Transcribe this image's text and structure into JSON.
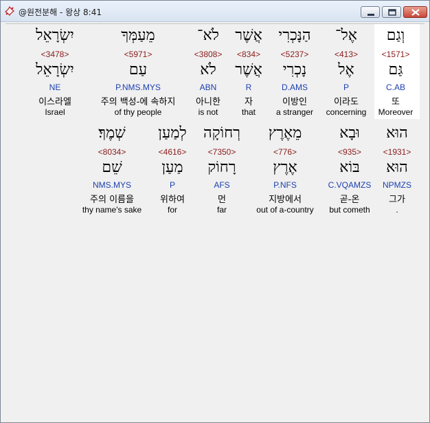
{
  "window": {
    "title": "@원전분해 - 왕상 8:41"
  },
  "row1": [
    {
      "hebrew": "יִשְׂרָאֵל",
      "strong": "<3478>",
      "lemma": "יִשְׂרָאֵל",
      "parse": "NE",
      "korean": "이스라엘",
      "english": "Israel"
    },
    {
      "hebrew": "מֵעַמְּךָ",
      "strong": "<5971>",
      "lemma": "עַם",
      "parse": "P.NMS.MYS",
      "korean": "주의 백성-에 속하지",
      "english": "of thy people"
    },
    {
      "hebrew": "לֹא־",
      "strong": "<3808>",
      "lemma": "לֹא",
      "parse": "ABN",
      "korean": "아니한",
      "english": "is not"
    },
    {
      "hebrew": "אֲשֶׁר",
      "strong": "<834>",
      "lemma": "אֲשֶׁר",
      "parse": "R",
      "korean": "자",
      "english": "that"
    },
    {
      "hebrew": "הַנָּכְרִי",
      "strong": "<5237>",
      "lemma": "נָכְרִי",
      "parse": "D.AMS",
      "korean": "이방인",
      "english": "a stranger"
    },
    {
      "hebrew": "אֶל־",
      "strong": "<413>",
      "lemma": "אֶל",
      "parse": "P",
      "korean": "이라도",
      "english": "concerning"
    },
    {
      "hebrew": "וְגַם",
      "strong": "<1571>",
      "lemma": "גַּם",
      "parse": "C.AB",
      "korean": "또",
      "english": "Moreover"
    }
  ],
  "row2": [
    {
      "hebrew": "שְׁמֶךָ׃",
      "strong": "<8034>",
      "lemma": "שֵׁם",
      "parse": "NMS.MYS",
      "korean": "주의 이름을",
      "english": "thy name's sake"
    },
    {
      "hebrew": "לְמַעַן",
      "strong": "<4616>",
      "lemma": "מַעַן",
      "parse": "P",
      "korean": "위하여",
      "english": "for"
    },
    {
      "hebrew": "רְחוֹקָה",
      "strong": "<7350>",
      "lemma": "רָחוֹק",
      "parse": "AFS",
      "korean": "먼",
      "english": "far"
    },
    {
      "hebrew": "מֵאֶרֶץ",
      "strong": "<776>",
      "lemma": "אֶרֶץ",
      "parse": "P.NFS",
      "korean": "지방에서",
      "english": "out of a-country"
    },
    {
      "hebrew": "וּבָא",
      "strong": "<935>",
      "lemma": "בּוֹא",
      "parse": "C.VQAMZS",
      "korean": "곧-온",
      "english": "but cometh"
    },
    {
      "hebrew": "הוּא",
      "strong": "<1931>",
      "lemma": "הוּא",
      "parse": "NPMZS",
      "korean": "그가",
      "english": "."
    }
  ]
}
